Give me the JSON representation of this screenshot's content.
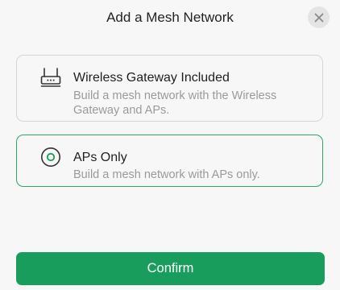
{
  "dialog": {
    "title": "Add a Mesh Network",
    "close_icon": "close-icon"
  },
  "options": [
    {
      "icon": "router-icon",
      "title": "Wireless Gateway Included",
      "description": "Build a mesh network with the Wireless Gateway and APs.",
      "selected": false
    },
    {
      "icon": "access-point-icon",
      "title": "APs Only",
      "description": "Build a mesh network with APs only.",
      "selected": true
    }
  ],
  "confirm_label": "Confirm",
  "colors": {
    "accent": "#189d5c",
    "selected_border": "#2fa56b"
  }
}
